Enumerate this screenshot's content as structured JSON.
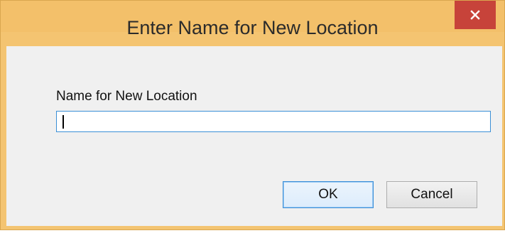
{
  "window": {
    "title": "Enter Name for New Location",
    "close_icon": "close-icon"
  },
  "form": {
    "label": "Name for New Location",
    "input_value": ""
  },
  "buttons": {
    "ok_label": "OK",
    "cancel_label": "Cancel"
  },
  "colors": {
    "titlebar": "#f3c06a",
    "close_button": "#c7433a",
    "client_background": "#f0f0f0",
    "focus_border": "#3a8fd6"
  }
}
